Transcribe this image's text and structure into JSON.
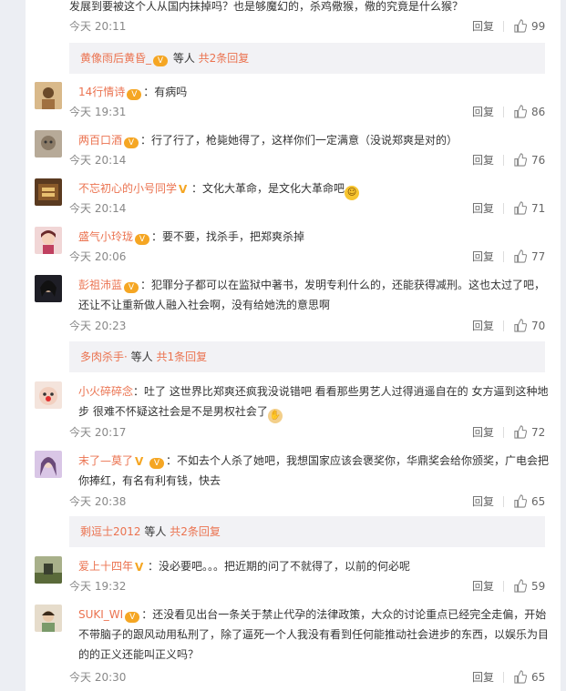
{
  "top": {
    "text": "发展到要被这个人从国内抹掉吗？也是够魔幻的，杀鸡儆猴，儆的究竟是什么猴？",
    "time": "今天 20:11",
    "reply": "回复",
    "likes": "99"
  },
  "subreply_1": {
    "user": "黄像雨后黄昏_",
    "middle": " 等人 ",
    "count": "共2条回复"
  },
  "comments": [
    {
      "user": "14行情诗",
      "badge": "vip",
      "text": "：有病吗",
      "time": "今天 19:31",
      "reply": "回复",
      "likes": "86",
      "avatar_color": "#c9a36a"
    },
    {
      "user": "两百口酒",
      "badge": "vip",
      "text": "：行了行了，枪毙她得了，这样你们一定满意（没说郑爽是对的）",
      "time": "今天 20:14",
      "reply": "回复",
      "likes": "76",
      "avatar_color": "#9a8b78"
    },
    {
      "user": "不忘初心的小号同学",
      "badge": "v",
      "text": "：文化大革命，是文化大革命吧",
      "emoji": "smile",
      "time": "今天 20:14",
      "reply": "回复",
      "likes": "71",
      "avatar_color": "#6b4a2a"
    },
    {
      "user": "盛气小玲珑",
      "badge": "vip",
      "text": "：要不要，找杀手，把郑爽杀掉",
      "time": "今天 20:06",
      "reply": "回复",
      "likes": "77",
      "avatar_color": "#d8a0a4"
    },
    {
      "user": "彭祖沛蓝",
      "badge": "vip",
      "text": "：犯罪分子都可以在监狱中著书，发明专利什么的，还能获得减刑。这也太过了吧，还让不让重新做人融入社会啊，没有给她洗的意思啊",
      "time": "今天 20:23",
      "reply": "回复",
      "likes": "70",
      "avatar_color": "#2b2b33"
    },
    {
      "user": "小火碎碎念",
      "badge": "",
      "text": "：吐了 这世界比郑爽还疯我没说错吧 看看那些男艺人过得逍遥自在的 女方逼到这种地步 很难不怀疑这社会是不是男权社会了",
      "emoji": "pray",
      "time": "今天 20:17",
      "reply": "回复",
      "likes": "72",
      "avatar_color": "#e9c6b8"
    },
    {
      "user": "末了—莫了",
      "badge": "vvip",
      "text": "：不如去个人杀了她吧，我想国家应该会褒奖你，华鼎奖会给你颁奖，广电会把你捧红，有名有利有钱，快去",
      "time": "今天 20:38",
      "reply": "回复",
      "likes": "65",
      "avatar_color": "#b89bc9"
    },
    {
      "user": "爱上十四年",
      "badge": "v",
      "text": "：没必要吧。。。把近期的问了不就得了，以前的何必呢",
      "time": "今天 19:32",
      "reply": "回复",
      "likes": "59",
      "avatar_color": "#7c8a5a"
    },
    {
      "user": "SUKI_WI",
      "badge": "vip",
      "text": "：还没看见出台一条关于禁止代孕的法律政策，大众的讨论重点已经完全走偏，开始不带脑子的跟风动用私刑了，除了逼死一个人我没有看到任何能推动社会进步的东西，以娱乐为目的的正义还能叫正义吗？",
      "time": "今天 20:30",
      "reply": "回复",
      "likes": "65",
      "avatar_color": "#c7b59c"
    }
  ],
  "subreply_2": {
    "user": "多肉杀手·",
    "middle": " 等人 ",
    "count": "共1条回复"
  },
  "subreply_3": {
    "user": "剩逗士2012",
    "middle": " 等人 ",
    "count": "共2条回复"
  },
  "icons": {
    "vip": "vip-badge-icon",
    "v": "v-badge-icon",
    "like": "thumb-up-icon"
  },
  "colors": {
    "username": "#eb7350",
    "meta": "#888888",
    "subreply_bg": "#f2f2f5",
    "page_bg": "#eceef3"
  }
}
